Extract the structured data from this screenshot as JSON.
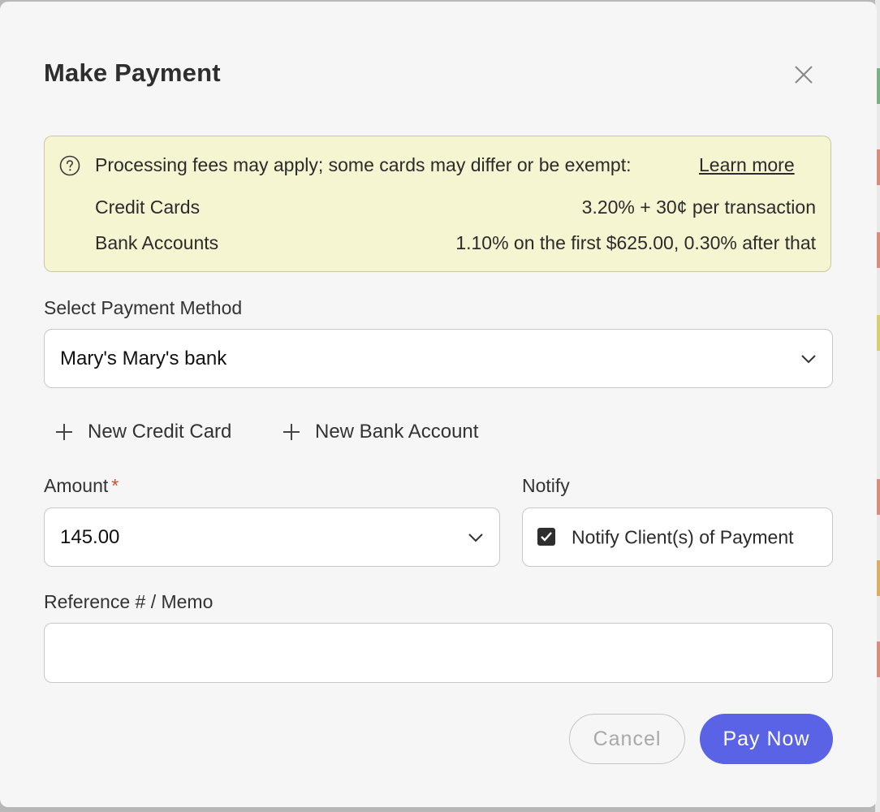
{
  "dialog": {
    "title": "Make Payment",
    "close_icon": "close-icon"
  },
  "fees_notice": {
    "icon": "help-circle-icon",
    "message": "Processing fees may apply; some cards may differ or be exempt:",
    "learn_more": "Learn more",
    "rows": [
      {
        "label": "Credit Cards",
        "value": "3.20% + 30¢ per transaction"
      },
      {
        "label": "Bank Accounts",
        "value": "1.10% on the first $625.00, 0.30% after that"
      }
    ],
    "background_color": "#f5f5d2"
  },
  "payment_method": {
    "label": "Select Payment Method",
    "selected": "Mary's Mary's bank",
    "icon": "chevron-down-icon"
  },
  "add_links": {
    "new_credit_card": "New Credit Card",
    "new_bank_account": "New Bank Account",
    "icon": "plus-icon"
  },
  "amount": {
    "label": "Amount",
    "required_marker": "*",
    "value": "145.00",
    "icon": "chevron-down-icon"
  },
  "notify": {
    "label": "Notify",
    "checkbox_label": "Notify Client(s) of Payment",
    "checked": true
  },
  "memo": {
    "label": "Reference # / Memo",
    "value": ""
  },
  "actions": {
    "cancel": "Cancel",
    "pay_now": "Pay Now",
    "primary_color": "#5a63e6"
  }
}
